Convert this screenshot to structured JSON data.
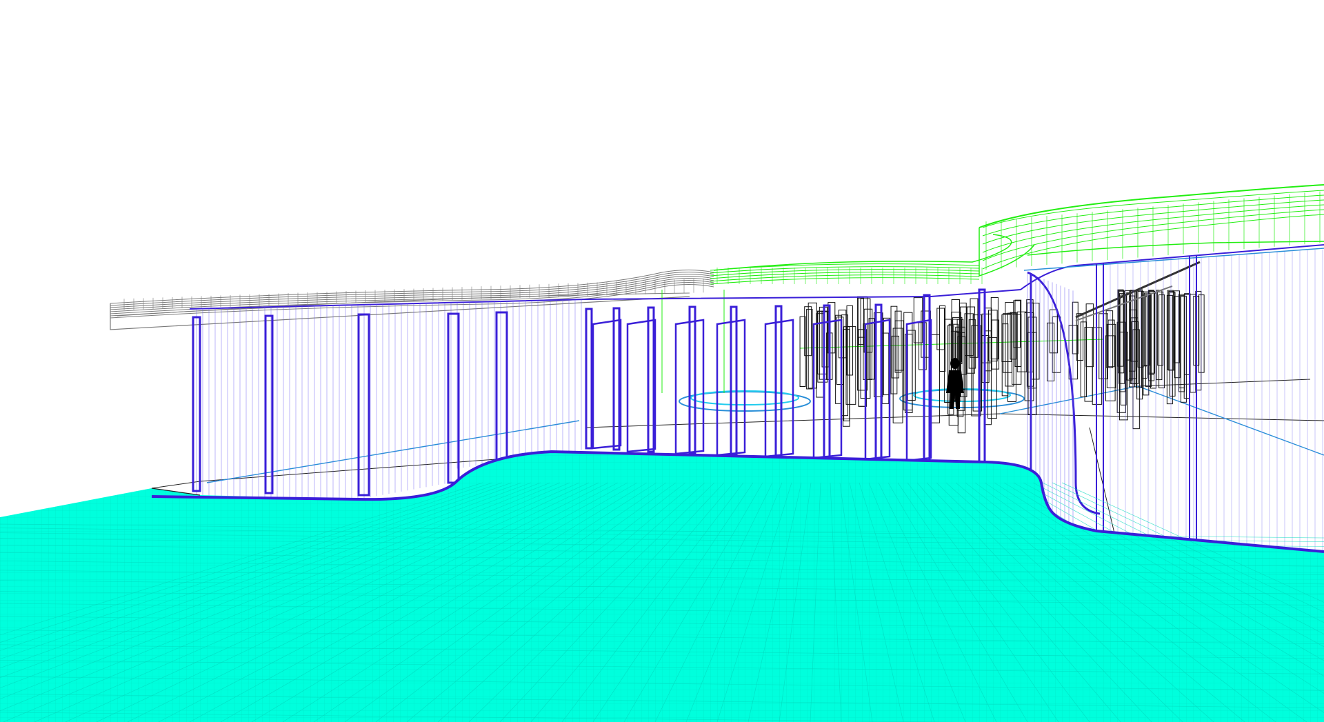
{
  "scene": {
    "view_mode": "wireframe",
    "background": "#ffffff",
    "layers": [
      {
        "name": "ground-floor-surface",
        "color": "#00ffdd"
      },
      {
        "name": "glass-facade-panels",
        "color": "#3a1fd8"
      },
      {
        "name": "glass-facade-mullions",
        "color": "#6a5cf0"
      },
      {
        "name": "roof-canopy-front",
        "color": "#7a7a7a"
      },
      {
        "name": "roof-canopy-rear",
        "color": "#22ee11"
      },
      {
        "name": "interior-fixtures",
        "color": "#111111"
      },
      {
        "name": "interior-floor-lines",
        "color": "#2a8fd8"
      },
      {
        "name": "human-figure",
        "color": "#000000"
      }
    ]
  }
}
